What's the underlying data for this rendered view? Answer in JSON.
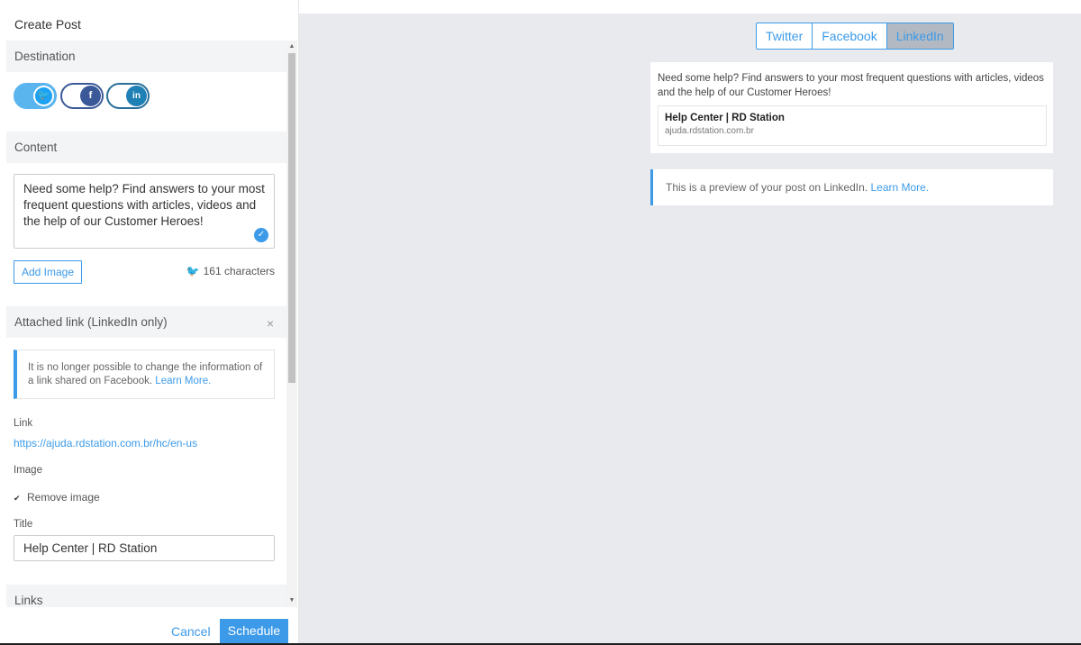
{
  "panel": {
    "title": "Create Post"
  },
  "sections": {
    "destination": "Destination",
    "content": "Content",
    "attached_link": "Attached link (LinkedIn only)",
    "links": "Links"
  },
  "destinations": [
    {
      "network": "twitter",
      "icon": "twitter-icon",
      "glyph": "🐦",
      "enabled": true
    },
    {
      "network": "facebook",
      "icon": "facebook-icon",
      "glyph": "f",
      "enabled": false
    },
    {
      "network": "linkedin",
      "icon": "linkedin-icon",
      "glyph": "in",
      "enabled": false
    }
  ],
  "content": {
    "text": "Need some help? Find answers to your most frequent questions with articles, videos and the help of our Customer Heroes!",
    "add_image_label": "Add Image",
    "char_count": "161 characters"
  },
  "attached_link": {
    "notice": "It is no longer possible to change the information of a link shared on Facebook.",
    "notice_link": "Learn More.",
    "link_label": "Link",
    "link_value": "https://ajuda.rdstation.com.br/hc/en-us",
    "image_label": "Image",
    "remove_image_label": "Remove image",
    "remove_image_checked": true,
    "title_label": "Title",
    "title_value": "Help Center | RD Station"
  },
  "footer": {
    "cancel": "Cancel",
    "schedule": "Schedule"
  },
  "preview": {
    "tabs": [
      "Twitter",
      "Facebook",
      "LinkedIn"
    ],
    "active_tab": "LinkedIn",
    "post_text": "Need some help? Find answers to your most frequent questions with articles, videos and the help of our Customer Heroes!",
    "card_title": "Help Center | RD Station",
    "card_url": "ajuda.rdstation.com.br",
    "note": "This is a preview of your post on LinkedIn.",
    "note_link": "Learn More."
  },
  "colors": {
    "accent": "#3c9ae8",
    "twitter": "#1da1f2",
    "facebook": "#3b5998",
    "linkedin": "#1f80b6"
  }
}
